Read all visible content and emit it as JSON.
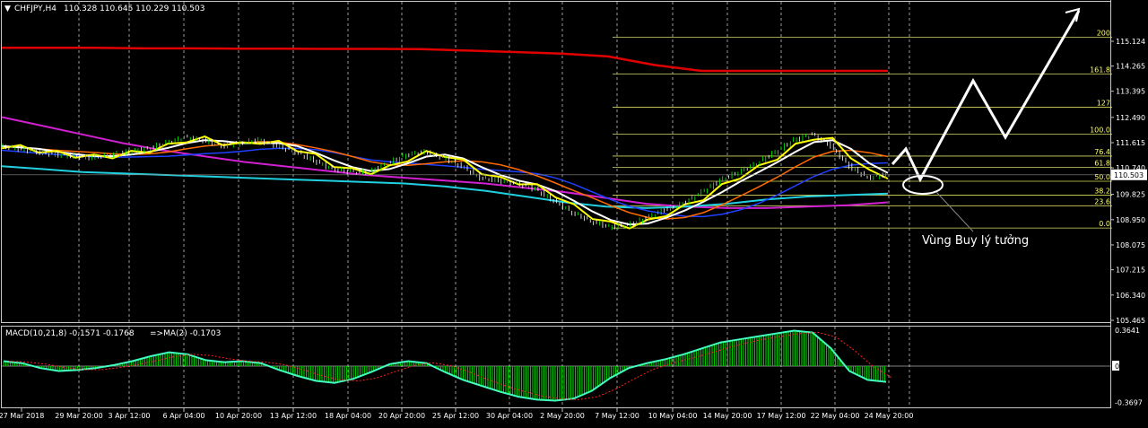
{
  "header": {
    "symbol": "CHFJPY,H4",
    "ohlc": "110.328 110.645 110.229 110.503"
  },
  "annotation": {
    "buy_zone_label": "Vùng Buy lý tưởng"
  },
  "macd_header": {
    "title": "MACD(10,21,8) -0.1571 -0.1768",
    "signal": "=>MA(2) -0.1703"
  },
  "colors": {
    "background": "#000000",
    "grid": "#c0c0c0",
    "axis_text": "#ffffff",
    "fib": "#d8d860",
    "fib_label": "#ffff66",
    "price_label_bg": "#ffffff",
    "ma_long_red": "#e00000",
    "ma_magenta": "#d020d0",
    "ma_cyan": "#20d0e0",
    "ma_blue": "#2040ff",
    "ma_white": "#ffffff",
    "ma_yellow": "#ffff00",
    "ma_orange": "#ff6a00",
    "bull_candle": "#00ff00",
    "bear_candle": "#ffffff",
    "macd_hist": "#00c000",
    "macd_line": "#40ffc0",
    "macd_signal": "#ff2020"
  },
  "chart_data": {
    "type": "candlestick",
    "title": "CHFJPY,H4",
    "price_axis": {
      "ticks": [
        "115.124",
        "114.265",
        "113.395",
        "112.490",
        "111.615",
        "110.740",
        "109.825",
        "108.950",
        "108.075",
        "107.215",
        "106.340",
        "105.465"
      ],
      "current_price": "110.503",
      "ylim": [
        105.465,
        115.3
      ]
    },
    "time_axis": {
      "ticks": [
        "27 Mar 2018",
        "29 Mar 20:00",
        "3 Apr 12:00",
        "6 Apr 04:00",
        "10 Apr 20:00",
        "13 Apr 12:00",
        "18 Apr 04:00",
        "20 Apr 20:00",
        "25 Apr 12:00",
        "30 Apr 04:00",
        "2 May 20:00",
        "7 May 12:00",
        "10 May 04:00",
        "14 May 20:00",
        "17 May 12:00",
        "22 May 04:00",
        "24 May 20:00"
      ]
    },
    "fibonacci": {
      "levels": [
        {
          "label": "0.0",
          "price": 108.66
        },
        {
          "label": "23.6",
          "price": 109.43
        },
        {
          "label": "38.2",
          "price": 109.8
        },
        {
          "label": "50.0",
          "price": 110.28
        },
        {
          "label": "61.8",
          "price": 110.76
        },
        {
          "label": "76.4",
          "price": 111.15
        },
        {
          "label": "100.0",
          "price": 111.91
        },
        {
          "label": "127",
          "price": 112.84
        },
        {
          "label": "161.8",
          "price": 113.99
        },
        {
          "label": "200",
          "price": 115.26
        }
      ]
    },
    "series": [
      {
        "name": "close",
        "values": [
          111.5,
          111.4,
          111.3,
          111.2,
          111.15,
          111.1,
          111.2,
          111.3,
          111.4,
          111.6,
          111.8,
          111.7,
          111.5,
          111.6,
          111.7,
          111.5,
          111.3,
          111.0,
          110.7,
          110.6,
          110.6,
          110.9,
          111.2,
          111.3,
          111.1,
          110.8,
          110.4,
          110.3,
          110.2,
          110.0,
          109.6,
          109.2,
          108.9,
          108.7,
          108.75,
          109.0,
          109.3,
          109.5,
          109.9,
          110.3,
          110.6,
          110.9,
          111.3,
          111.7,
          111.9,
          111.5,
          110.8,
          110.4,
          110.5
        ]
      }
    ],
    "macd": {
      "params": "MACD(10,21,8)",
      "main": -0.1571,
      "signal": -0.1768,
      "ma2": -0.1703,
      "axis_ticks": [
        "0.3641",
        "0.00",
        "-0.3697"
      ],
      "values": [
        0.05,
        0.03,
        -0.02,
        -0.05,
        -0.04,
        -0.02,
        0.01,
        0.05,
        0.1,
        0.14,
        0.12,
        0.06,
        0.04,
        0.05,
        0.03,
        -0.04,
        -0.1,
        -0.15,
        -0.17,
        -0.13,
        -0.06,
        0.02,
        0.05,
        0.03,
        -0.06,
        -0.14,
        -0.2,
        -0.26,
        -0.31,
        -0.34,
        -0.35,
        -0.33,
        -0.25,
        -0.12,
        -0.02,
        0.03,
        0.07,
        0.12,
        0.18,
        0.24,
        0.27,
        0.3,
        0.33,
        0.36,
        0.34,
        0.18,
        -0.05,
        -0.14,
        -0.16
      ]
    }
  }
}
